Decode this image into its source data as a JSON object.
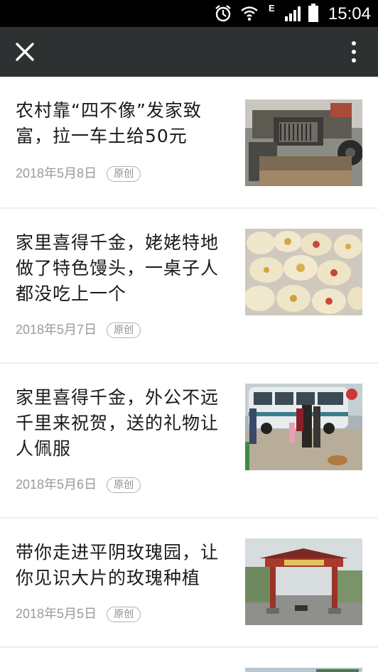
{
  "status_bar": {
    "time": "15:04",
    "network": "E",
    "icons": [
      "alarm-icon",
      "wifi-icon",
      "signal-icon",
      "battery-icon"
    ]
  },
  "nav": {
    "close_icon": "close-icon",
    "more_icon": "more-vertical-icon"
  },
  "articles": [
    {
      "title": "农村靠“四不像”发家致富，拉一车土给50元",
      "date": "2018年5月8日",
      "badge": "原创",
      "thumb": "machine-photo"
    },
    {
      "title": "家里喜得千金，姥姥特地做了特色馒头，一桌子人都没吃上一个",
      "date": "2018年5月7日",
      "badge": "原创",
      "thumb": "buns-photo"
    },
    {
      "title": "家里喜得千金，外公不远千里来祝贺，送的礼物让人佩服",
      "date": "2018年5月6日",
      "badge": "原创",
      "thumb": "bus-photo"
    },
    {
      "title": "带你走进平阴玫瑰园，让你见识大片的玫瑰种植",
      "date": "2018年5月5日",
      "badge": "原创",
      "thumb": "gate-photo"
    }
  ],
  "colors": {
    "status_bar": "#000000",
    "nav_bar": "#2e3132",
    "background": "#efeff4",
    "title_text": "#1a1a1a",
    "meta_text": "#9a9a9a"
  }
}
